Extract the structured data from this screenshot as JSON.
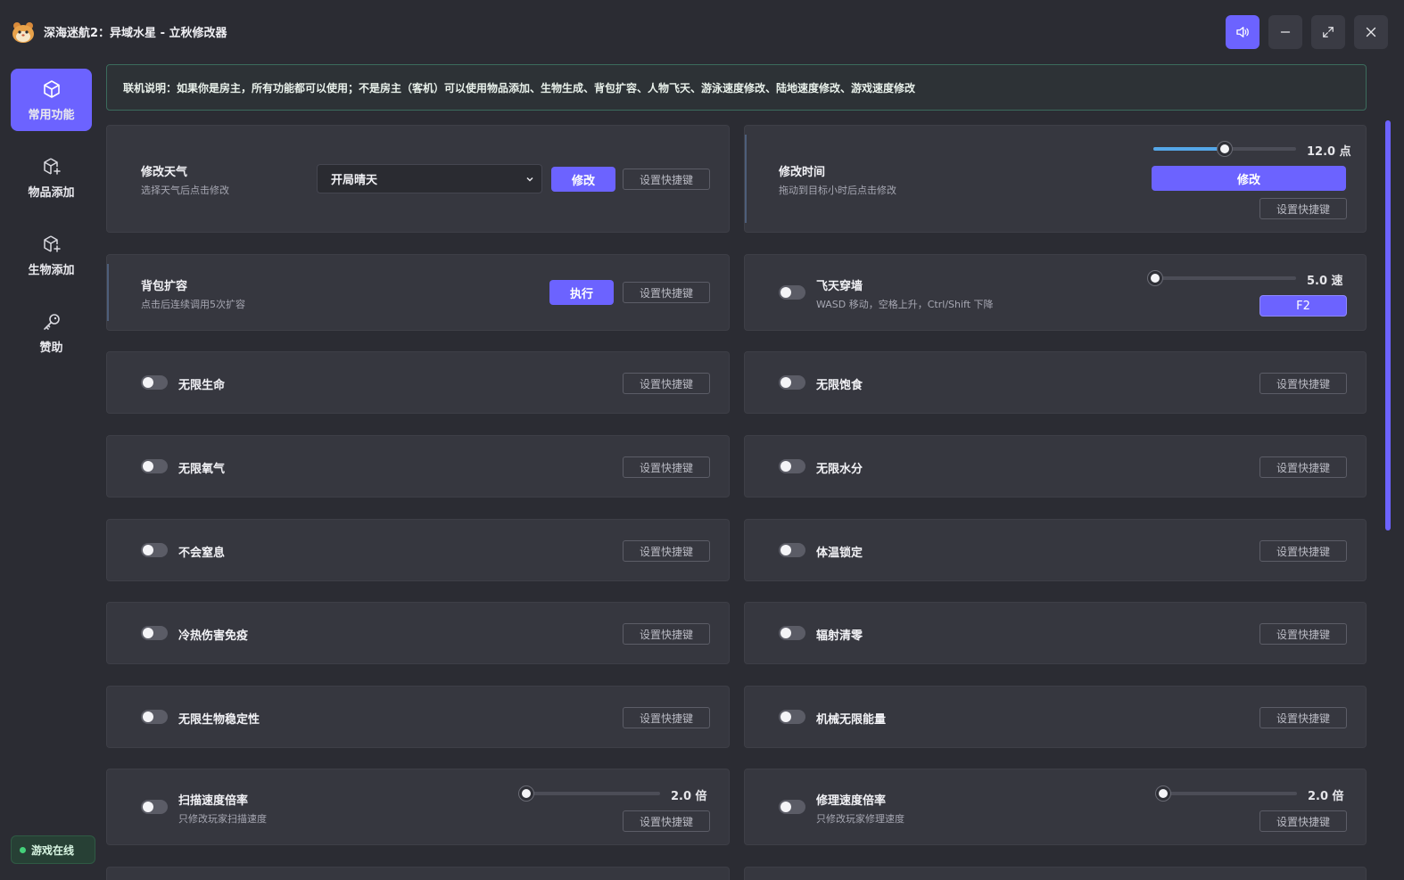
{
  "app": {
    "title": "深海迷航2：异域水星 - 立秋修改器",
    "logo": "hamster-logo"
  },
  "window_controls": {
    "sound": "speaker-icon",
    "minimize": "minimize-icon",
    "maximize": "maximize-icon",
    "close": "close-icon"
  },
  "sidebar": {
    "items": [
      {
        "label": "常用功能",
        "icon": "cube-icon",
        "active": true
      },
      {
        "label": "物品添加",
        "icon": "cube-plus-icon",
        "active": false
      },
      {
        "label": "生物添加",
        "icon": "cube-plus-icon",
        "active": false
      },
      {
        "label": "赞助",
        "icon": "key-icon",
        "active": false
      }
    ],
    "status": "游戏在线"
  },
  "notice": "联机说明：如果你是房主，所有功能都可以使用；不是房主（客机）可以使用物品添加、生物生成、背包扩容、人物飞天、游泳速度修改、陆地速度修改、游戏速度修改",
  "shortcut_label": "设置快捷键",
  "weather": {
    "title": "修改天气",
    "sub": "选择天气后点击修改",
    "selected": "开局晴天",
    "button": "修改"
  },
  "time": {
    "title": "修改时间",
    "sub": "拖动到目标小时后点击修改",
    "value": "12.0 点",
    "level": 0.5,
    "button": "修改"
  },
  "backpack": {
    "title": "背包扩容",
    "sub": "点击后连续调用5次扩容",
    "button": "执行"
  },
  "fly": {
    "title": "飞天穿墙",
    "sub": "WASD 移动，空格上升，Ctrl/Shift 下降",
    "value": "5.0 速",
    "level": 0.0,
    "hotkey": "F2"
  },
  "toggles_left": [
    "无限生命",
    "无限氧气",
    "不会窒息",
    "冷热伤害免疫",
    "无限生物稳定性"
  ],
  "toggles_right": [
    "无限饱食",
    "无限水分",
    "体温锁定",
    "辐射清零",
    "机械无限能量"
  ],
  "scan": {
    "title": "扫描速度倍率",
    "sub": "只修改玩家扫描速度",
    "value": "2.0 倍",
    "level": 0.05
  },
  "repair": {
    "title": "修理速度倍率",
    "sub": "只修改玩家修理速度",
    "value": "2.0 倍",
    "level": 0.05
  },
  "colors": {
    "accent": "#6c63ff",
    "slider_fill": "#55a7e8",
    "online": "#44d17a"
  }
}
